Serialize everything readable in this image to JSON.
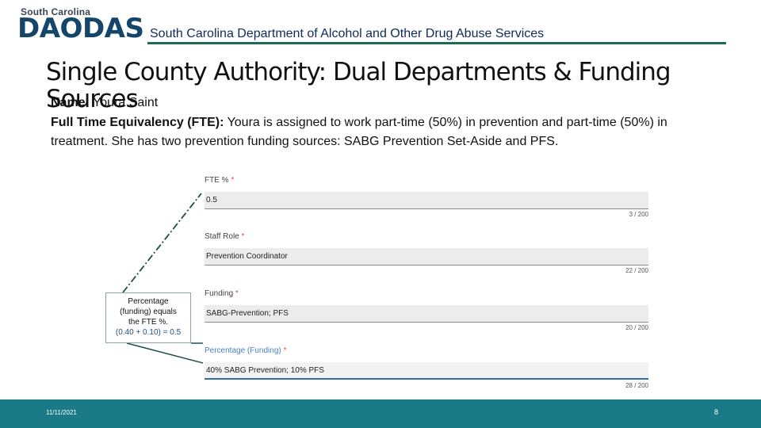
{
  "header": {
    "logo_state": "South Carolina",
    "logo_name": "DAODAS",
    "subtitle": "South Carolina Department of Alcohol and Other Drug Abuse Services"
  },
  "slide": {
    "title": "Single County Authority: Dual Departments & Funding Sources",
    "name_label": "Name:",
    "name_value": "Youra Saint",
    "fte_label": "Full Time Equivalency (FTE):",
    "fte_text": "Youra is assigned to work part-time (50%) in prevention and part-time (50%) in treatment. She has two prevention funding sources:  SABG Prevention Set-Aside and PFS."
  },
  "form": {
    "fields": [
      {
        "label": "FTE %",
        "required_mark": "*",
        "value": "0.5",
        "counter": "3 / 200"
      },
      {
        "label": "Staff Role",
        "required_mark": "*",
        "value": "Prevention Coordinator",
        "counter": "22 / 200"
      },
      {
        "label": "Funding",
        "required_mark": "*",
        "value": "SABG-Prevention; PFS",
        "counter": "20 / 200"
      },
      {
        "label": "Percentage (Funding)",
        "required_mark": "*",
        "value": "40% SABG Prevention; 10% PFS",
        "counter": "28 / 200"
      }
    ]
  },
  "callout": {
    "line1": "Percentage",
    "line2": "(funding) equals",
    "line3": "the FTE %.",
    "formula": "(0.40 + 0.10) = 0.5"
  },
  "footer": {
    "date": "11/11/2021",
    "page": "8"
  },
  "colors": {
    "footer_bg": "#1a7a86",
    "header_rule": "#1d6b52",
    "logo": "#14456b",
    "required": "#d9534f",
    "focus_label": "#4a7fbf"
  }
}
